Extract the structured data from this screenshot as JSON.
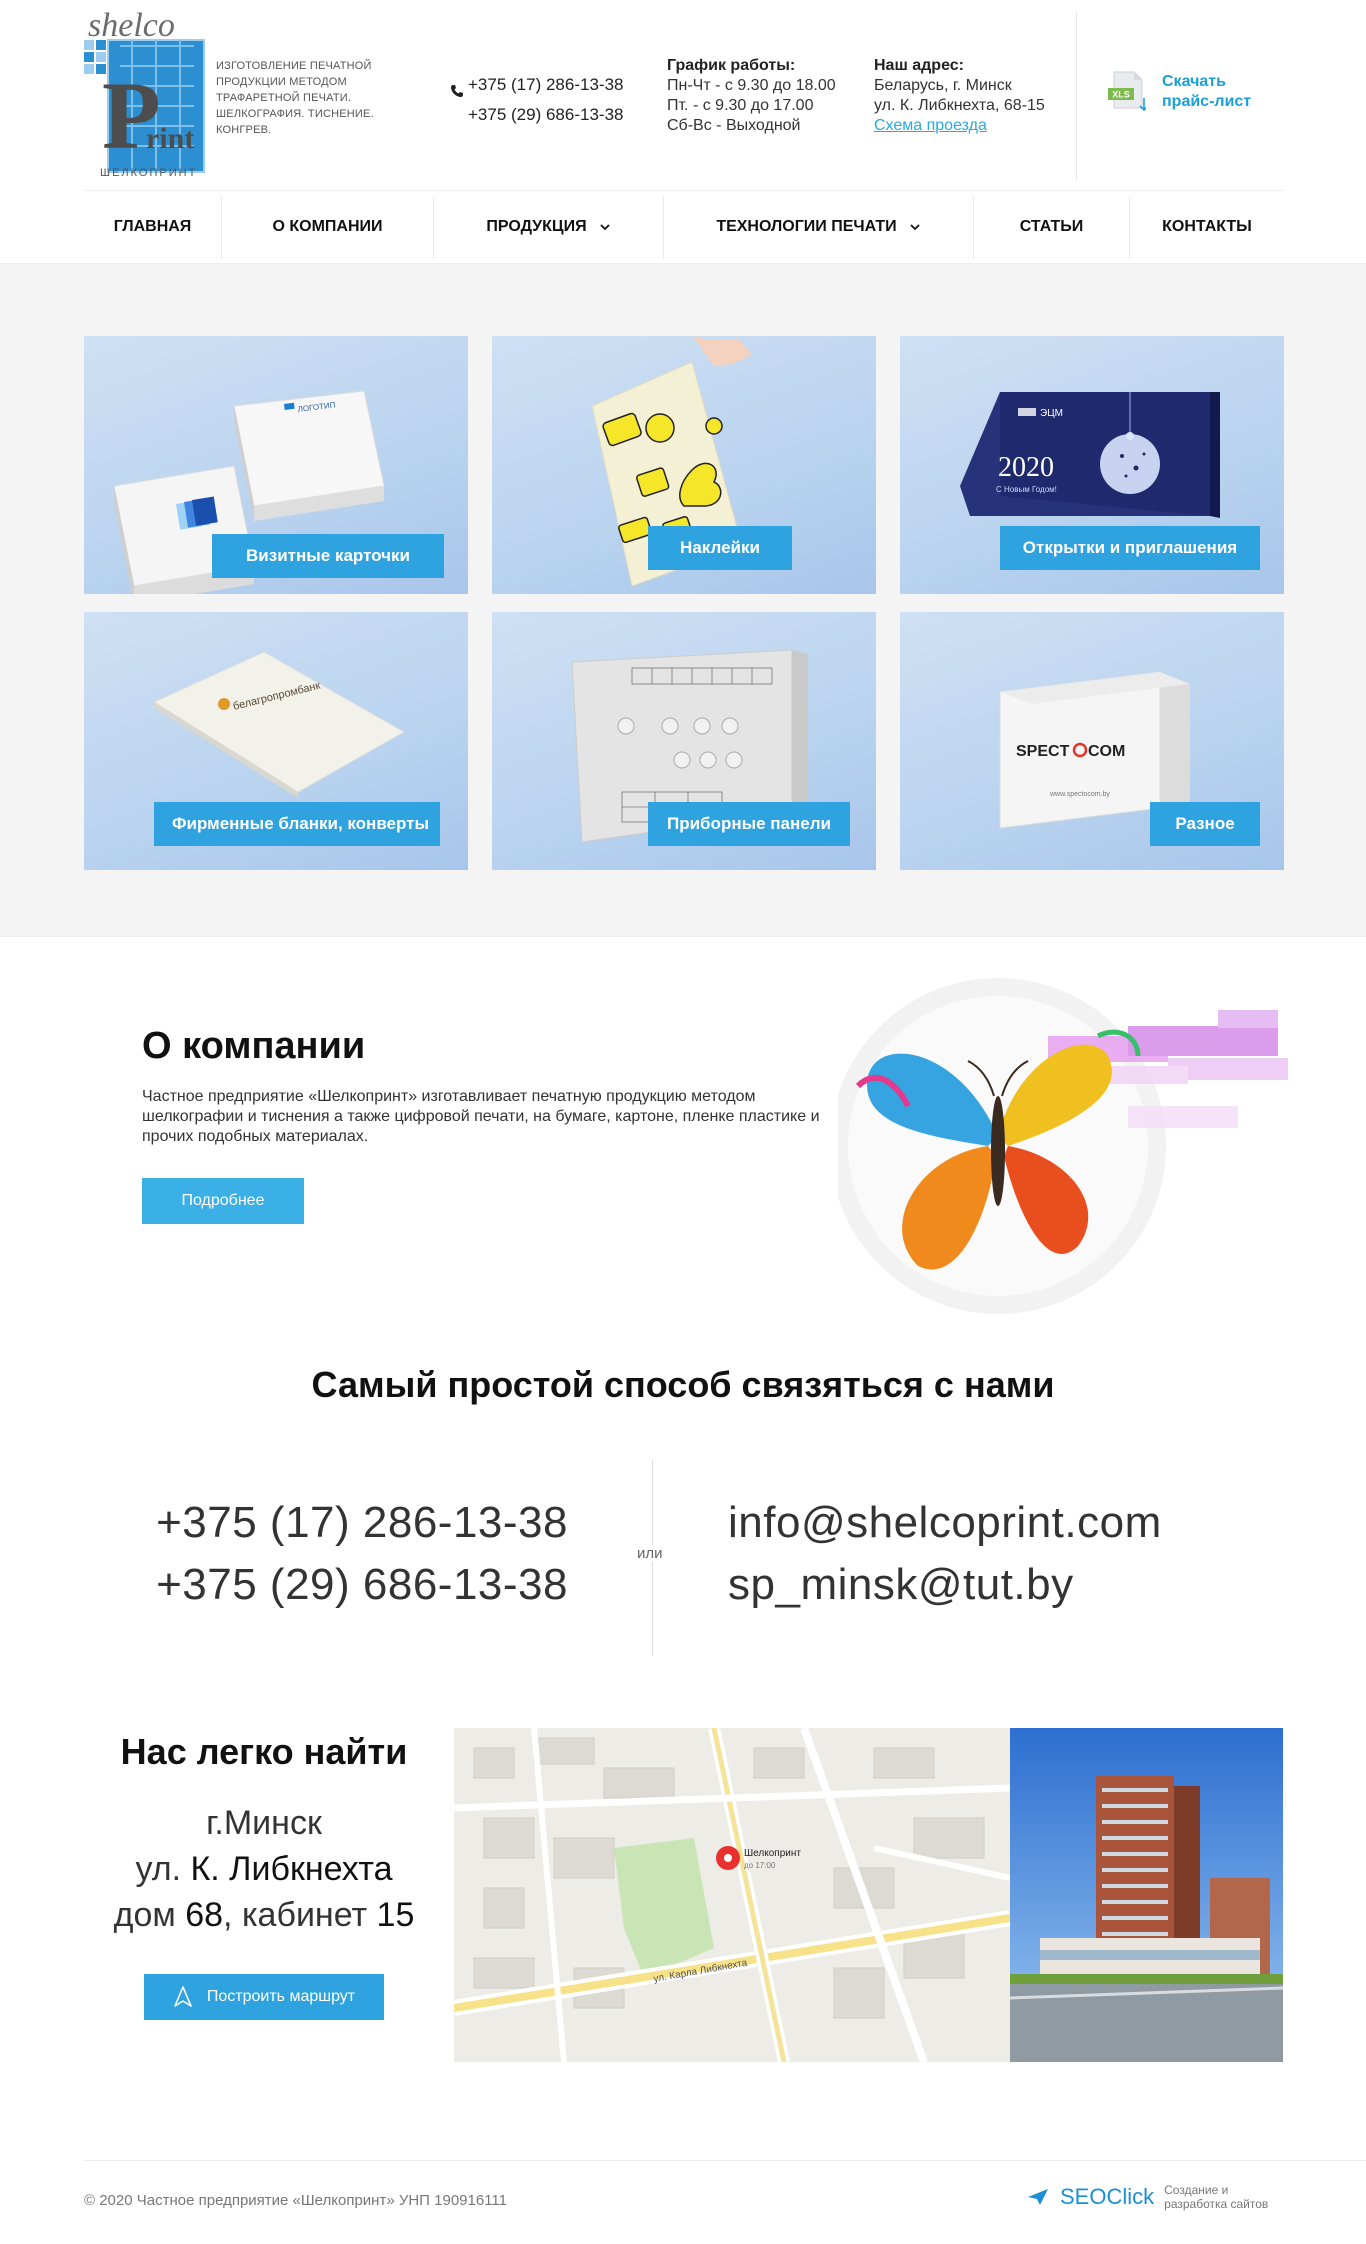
{
  "header": {
    "logo_top": "shelco",
    "logo_bottom": "Print",
    "logo_sub": "ШЕЛКОПРИНТ",
    "logo_desc": "Изготовление печатной продукции методом трафаретной печати. Шелкография. Тиснение. Конгрев.",
    "phones": [
      "+375 (17) 286-13-38",
      "+375 (29) 686-13-38"
    ],
    "schedule_title": "График работы:",
    "schedule_lines": [
      "Пн-Чт - с 9.30 до 18.00",
      "Пт. - с 9.30 до 17.00",
      "Сб-Вс - Выходной"
    ],
    "address_title": "Наш адрес:",
    "address_lines": [
      "Беларусь, г. Минск",
      "ул. К. Либкнехта, 68-15"
    ],
    "address_link": "Схема проезда",
    "price_label": "Скачать прайс-лист",
    "xls_badge": "XLS"
  },
  "nav": [
    {
      "label": "Главная",
      "has_arrow": false
    },
    {
      "label": "О компании",
      "has_arrow": false
    },
    {
      "label": "Продукция",
      "has_arrow": true
    },
    {
      "label": "Технологии печати",
      "has_arrow": true
    },
    {
      "label": "Статьи",
      "has_arrow": false
    },
    {
      "label": "Контакты",
      "has_arrow": false
    }
  ],
  "products": [
    {
      "label": "Визитные карточки"
    },
    {
      "label": "Наклейки"
    },
    {
      "label": "Открытки и приглашения"
    },
    {
      "label": "Фирменные бланки, конверты"
    },
    {
      "label": "Приборные панели"
    },
    {
      "label": "Разное"
    }
  ],
  "product_art": {
    "card_brand": "ЛОГОТИП",
    "postcard_year": "2020",
    "postcard_greeting": "С Новым Годом!",
    "postcard_logo": "ЭЦМ",
    "envelope_brand": "белагропромбанк",
    "box_brand_left": "SPECT",
    "box_brand_right": "COM",
    "box_url": "www.spectocom.by"
  },
  "about": {
    "title": "О компании",
    "text": "Частное предприятие «Шелкопринт» изготавливает печатную продукцию методом шелкографии и тиснения а также цифровой печати, на бумаге, картоне, пленке пластике и прочих подобных материалах.",
    "button": "Подробнее"
  },
  "contact": {
    "title": "Самый простой способ связяться с нами",
    "phones": [
      "+375 (17) 286-13-38",
      "+375 (29) 686-13-38"
    ],
    "or": "или",
    "emails": [
      "info@shelcoprint.com",
      "sp_minsk@tut.by"
    ]
  },
  "find": {
    "title": "Нас легко найти",
    "city": "г.Минск",
    "street_prefix": "ул.",
    "street": "К. Либкнехта",
    "house_prefix": "дом",
    "house": "68",
    "office_prefix": ", кабинет",
    "office": "15",
    "button": "Построить маршрут",
    "map_pin_title": "Шелкопринт",
    "map_pin_hours": "до 17:00",
    "map_street": "ул. Карла Либкнехта"
  },
  "footer": {
    "copyright": "© 2020 Частное предприятие «Шелкопринт» УНП 190916111",
    "seo_brand_a": "SEO",
    "seo_brand_b": "Click",
    "seo_note": "Создание и разработка сайтов"
  },
  "colors": {
    "accent": "#2ea3df",
    "link": "#29a9e0",
    "card_bg": "#bcd4ef"
  }
}
